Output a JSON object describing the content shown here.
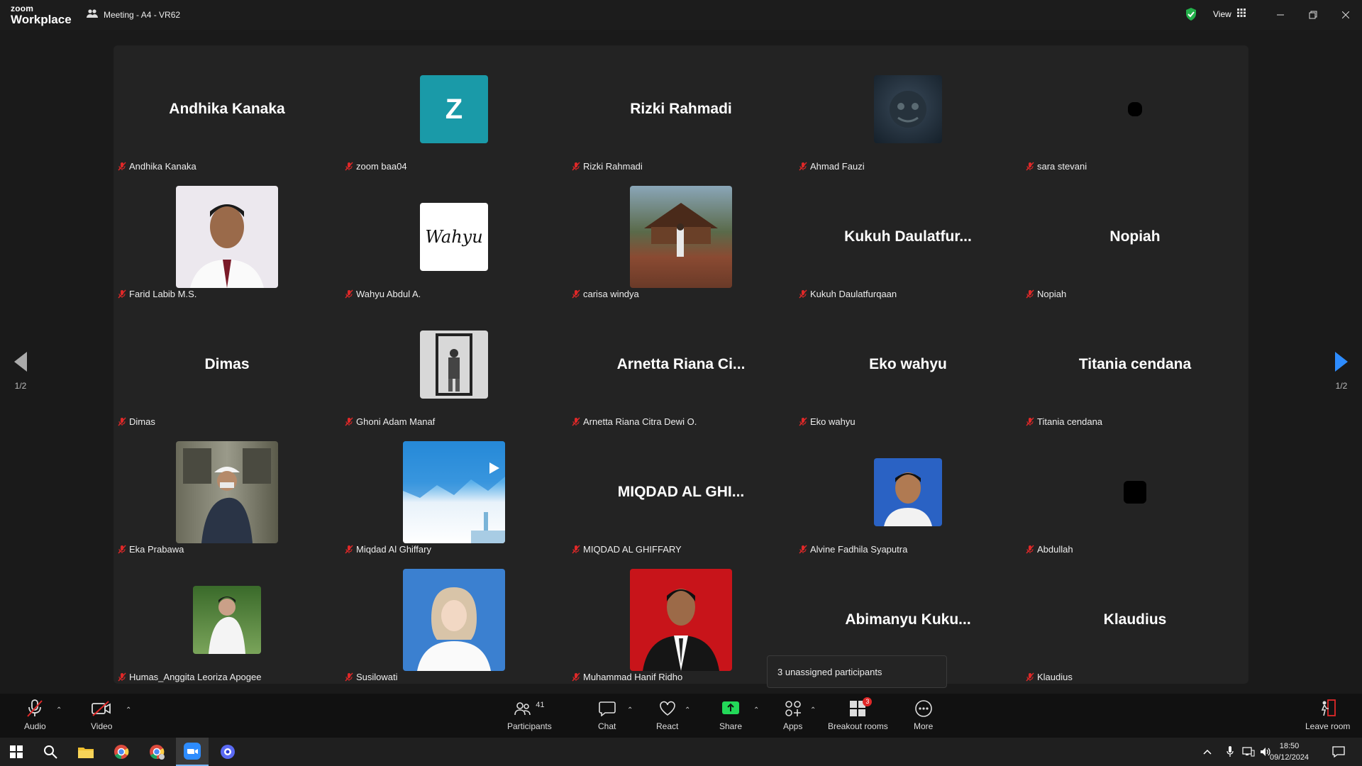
{
  "app": {
    "brand_top": "zoom",
    "brand_bottom": "Workplace",
    "meeting_title": "Meeting - A4 - VR62",
    "view_label": "View"
  },
  "participants": [
    {
      "display": "Andhika Kanaka",
      "label": "Andhika Kanaka"
    },
    {
      "display": "Z",
      "label": "zoom baa04"
    },
    {
      "display": "Rizki Rahmadi",
      "label": "Rizki Rahmadi"
    },
    {
      "display": "",
      "label": "Ahmad Fauzi"
    },
    {
      "display": "",
      "label": "sara stevani"
    },
    {
      "display": "",
      "label": "Farid Labib M.S."
    },
    {
      "display": "",
      "label": "Wahyu Abdul A."
    },
    {
      "display": "",
      "label": "carisa windya"
    },
    {
      "display": "Kukuh  Daulatfur...",
      "label": "Kukuh Daulatfurqaan"
    },
    {
      "display": "Nopiah",
      "label": "Nopiah"
    },
    {
      "display": "Dimas",
      "label": "Dimas"
    },
    {
      "display": "",
      "label": "Ghoni Adam Manaf"
    },
    {
      "display": "Arnetta  Riana  Ci...",
      "label": "Arnetta Riana Citra Dewi O."
    },
    {
      "display": "Eko wahyu",
      "label": "Eko wahyu"
    },
    {
      "display": "Titania cendana",
      "label": "Titania cendana"
    },
    {
      "display": "",
      "label": "Eka Prabawa"
    },
    {
      "display": "",
      "label": "Miqdad Al Ghiffary"
    },
    {
      "display": "MIQDAD  AL GHI...",
      "label": "MIQDAD AL GHIFFARY"
    },
    {
      "display": "",
      "label": "Alvine Fadhila Syaputra"
    },
    {
      "display": "",
      "label": "Abdullah"
    },
    {
      "display": "",
      "label": "Humas_Anggita Leoriza Apogee"
    },
    {
      "display": "",
      "label": "Susilowati"
    },
    {
      "display": "",
      "label": "Muhammad Hanif Ridho"
    },
    {
      "display": "Abimanyu  Kuku...",
      "label": ""
    },
    {
      "display": "Klaudius",
      "label": "Klaudius"
    }
  ],
  "avatar_texts": {
    "wahyu_signature": "Wahyu"
  },
  "pager": {
    "left": "1/2",
    "right": "1/2"
  },
  "tooltip": "3 unassigned participants",
  "toolbar": {
    "audio": "Audio",
    "video": "Video",
    "participants": "Participants",
    "participants_count": "41",
    "chat": "Chat",
    "react": "React",
    "share": "Share",
    "apps": "Apps",
    "breakout": "Breakout rooms",
    "breakout_badge": "3",
    "more": "More",
    "leave": "Leave room"
  },
  "taskbar": {
    "time": "18:50",
    "date": "09/12/2024"
  },
  "colors": {
    "share_green": "#23d959",
    "muted_red": "#e02828",
    "accent_blue": "#2d8cff",
    "teal_avatar": "#1a9aa8"
  }
}
